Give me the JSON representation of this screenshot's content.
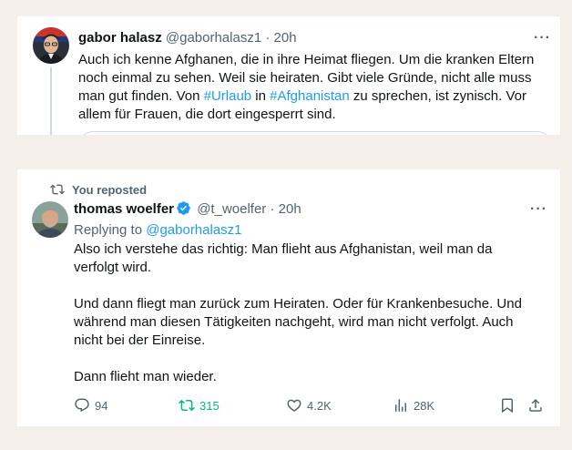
{
  "tweet1": {
    "name": "gabor halasz",
    "handle": "@gaborhalasz1",
    "sep": "·",
    "time": "20h",
    "more": "···",
    "text_a": "Auch ich kenne Afghanen, die in ihre Heimat fliegen. Um die kranken Eltern noch einmal zu sehen. Weil sie heiraten. Gibt viele Gründe, nicht alle muss man gut finden. Von ",
    "tag1": "#Urlaub",
    "text_b": " in ",
    "tag2": "#Afghanistan",
    "text_c": " zu sprechen, ist zynisch. Vor allem für Frauen, die dort eingesperrt sind."
  },
  "tweet2": {
    "repost_label": "You reposted",
    "name": "thomas woelfer",
    "handle": "@t_woelfer",
    "sep": "·",
    "time": "20h",
    "more": "···",
    "replying_prefix": "Replying to ",
    "replying_handle": "@gaborhalasz1",
    "paragraphs": [
      "Also ich verstehe das richtig: Man flieht aus Afghanistan, weil man da verfolgt wird.",
      "Und dann fliegt man zurück zum Heiraten. Oder für Krankenbesuche. Und während man diesen Tätigkeiten nachgeht, wird man nicht verfolgt. Auch nicht bei der Einreise.",
      "Dann flieht man wieder."
    ],
    "actions": {
      "replies": "94",
      "reposts": "315",
      "likes": "4.2K",
      "views": "28K"
    }
  },
  "colors": {
    "background": "#f4f0e9",
    "link": "#1d9bf0",
    "secondary_text": "#536471",
    "repost_green": "#00ba7c",
    "verified": "#1d9bf0"
  },
  "icons": {
    "repost": "repost-icon",
    "verified": "verified-badge-icon",
    "reply": "reply-icon",
    "like": "heart-icon",
    "views": "views-chart-icon",
    "bookmark": "bookmark-icon",
    "share": "share-icon"
  }
}
